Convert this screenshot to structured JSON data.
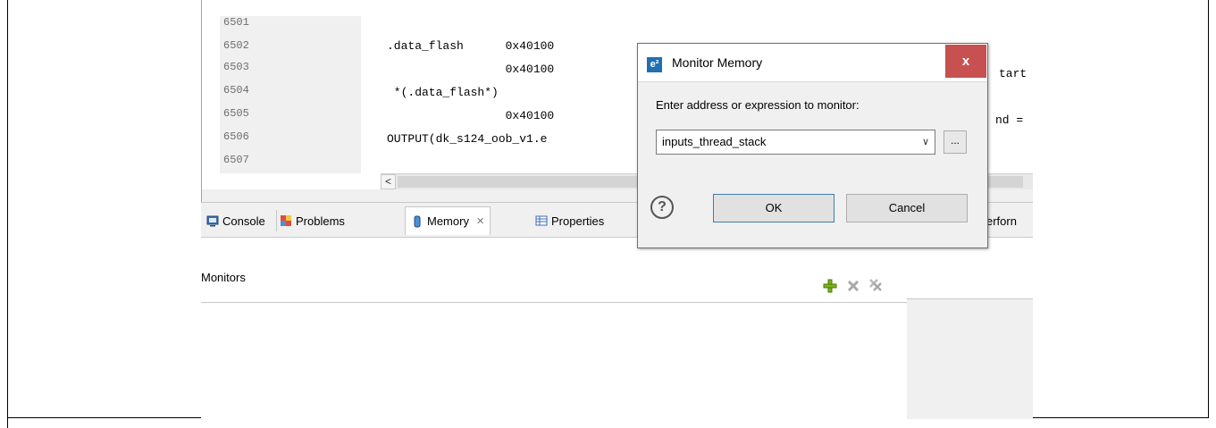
{
  "editor": {
    "line_numbers": [
      "6501",
      "6502",
      "6503",
      "6504",
      "6505",
      "6506",
      "6507"
    ],
    "code_lines": [
      ".data_flash      0x40100",
      "                 0x40100",
      " *(.data_flash*)",
      "                 0x40100",
      "OUTPUT(dk_s124_oob_v1.e"
    ],
    "clipped_right": [
      "tart",
      "nd ="
    ],
    "scroll_left_glyph": "<"
  },
  "tabs": [
    {
      "label": "Console",
      "icon": "console-icon"
    },
    {
      "label": "Problems",
      "icon": "problems-icon"
    },
    {
      "label": "Memory",
      "icon": "memory-icon",
      "active": true,
      "close": "✕"
    },
    {
      "label": "Properties",
      "icon": "properties-icon"
    },
    {
      "label": "erforn",
      "icon": "none"
    }
  ],
  "panel": {
    "monitors_label": "Monitors",
    "toolbar": [
      "add-monitor-icon",
      "remove-monitor-icon",
      "remove-all-monitors-icon"
    ]
  },
  "dialog": {
    "app_icon": "e²",
    "title": "Monitor Memory",
    "close_glyph": "x",
    "prompt": "Enter address or expression to monitor:",
    "expression_value": "inputs_thread_stack",
    "dropdown_glyph": "∨",
    "browse_label": "...",
    "help_glyph": "?",
    "ok_label": "OK",
    "cancel_label": "Cancel"
  },
  "colors": {
    "close_button": "#c75050",
    "gutter": "#f0f0f0",
    "ok_border": "#3c7fb1",
    "add_icon": "#7ab317"
  }
}
